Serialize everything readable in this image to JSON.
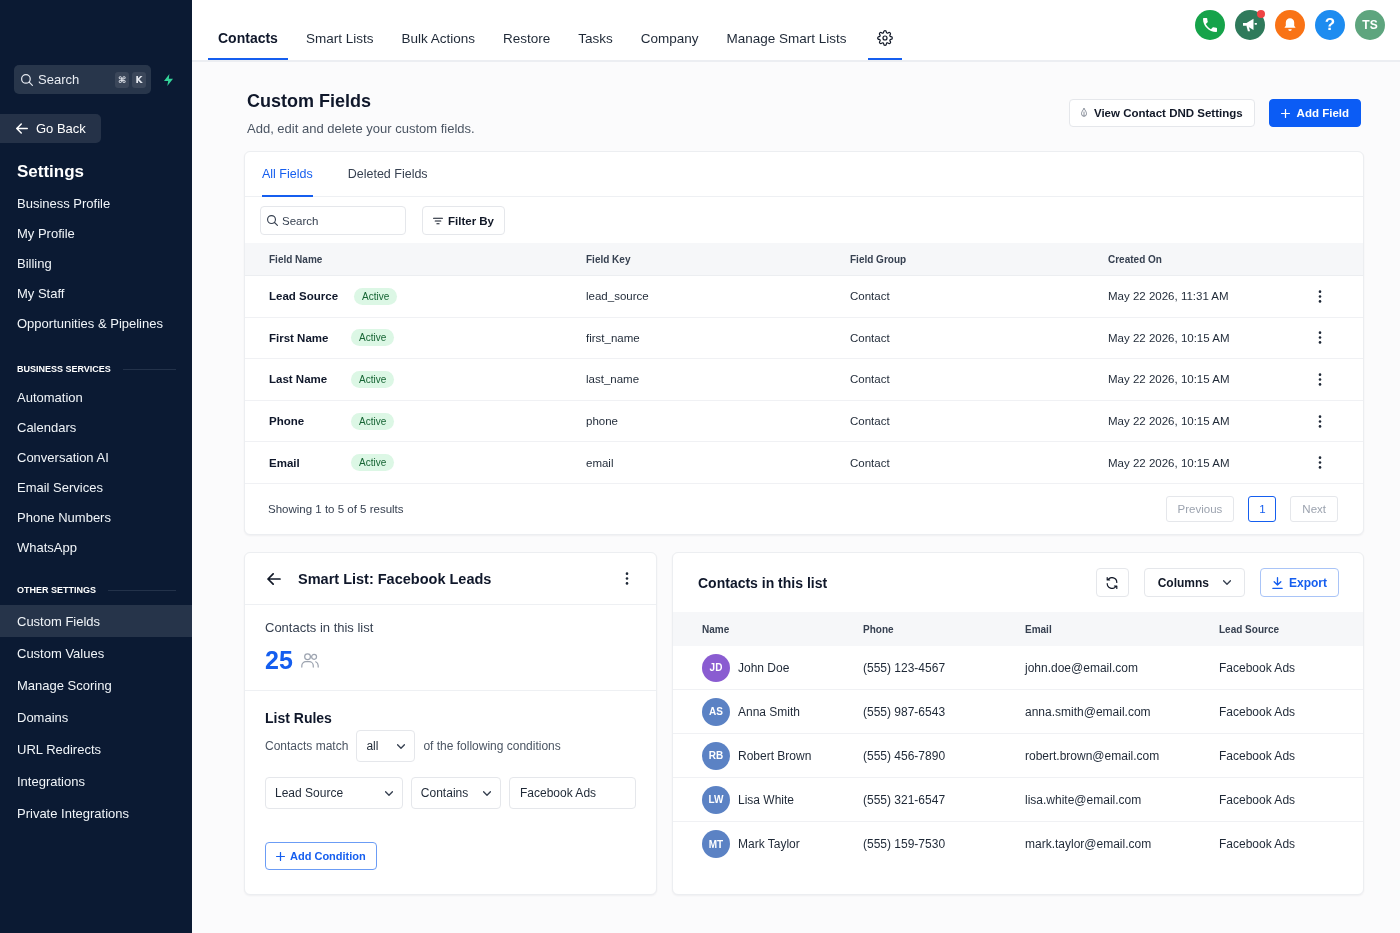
{
  "sidebar": {
    "search": {
      "placeholder": "Search",
      "shortcut": [
        "⌘",
        "K"
      ]
    },
    "back": "Go Back",
    "title": "Settings",
    "groups": [
      {
        "items": [
          {
            "label": "Business Profile",
            "selected": false
          },
          {
            "label": "My Profile",
            "selected": false
          },
          {
            "label": "Billing",
            "selected": false
          },
          {
            "label": "My Staff",
            "selected": false
          },
          {
            "label": "Opportunities & Pipelines",
            "selected": false
          }
        ]
      },
      {
        "title": "BUSINESS SERVICES",
        "items": [
          {
            "label": "Automation",
            "selected": false
          },
          {
            "label": "Calendars",
            "selected": false
          },
          {
            "label": "Conversation AI",
            "selected": false
          },
          {
            "label": "Email Services",
            "selected": false
          },
          {
            "label": "Phone Numbers",
            "selected": false
          },
          {
            "label": "WhatsApp",
            "selected": false
          }
        ]
      },
      {
        "title": "OTHER SETTINGS",
        "items": [
          {
            "label": "Custom Fields",
            "selected": true
          },
          {
            "label": "Custom Values",
            "selected": false
          },
          {
            "label": "Manage Scoring",
            "selected": false
          },
          {
            "label": "Domains",
            "selected": false
          },
          {
            "label": "URL Redirects",
            "selected": false
          },
          {
            "label": "Integrations",
            "selected": false
          },
          {
            "label": "Private Integrations",
            "selected": false
          }
        ]
      }
    ]
  },
  "topbar": {
    "tabs": [
      {
        "kind": "text",
        "label": "Contacts",
        "selected": true
      },
      {
        "kind": "text",
        "label": "Smart Lists",
        "selected": false
      },
      {
        "kind": "text",
        "label": "Bulk Actions",
        "selected": false
      },
      {
        "kind": "text",
        "label": "Restore",
        "selected": false
      },
      {
        "kind": "text",
        "label": "Tasks",
        "selected": false
      },
      {
        "kind": "text",
        "label": "Company",
        "selected": false
      },
      {
        "kind": "text",
        "label": "Manage Smart Lists",
        "selected": false
      },
      {
        "kind": "settings",
        "selected": true
      }
    ],
    "actions": [
      {
        "kind": "phone"
      },
      {
        "kind": "campaigns",
        "badge": true
      },
      {
        "kind": "notifications"
      },
      {
        "kind": "help",
        "glyph": "?"
      },
      {
        "kind": "avatar",
        "initials": "TS"
      }
    ]
  },
  "page": {
    "title": "Custom Fields",
    "subtitle": "Add, edit and delete your custom fields.",
    "actions": [
      {
        "kind": "secondary",
        "label": "View Contact DND Settings"
      },
      {
        "kind": "primary",
        "label": "Add Field"
      }
    ]
  },
  "fields_card": {
    "tabs": [
      {
        "label": "All Fields",
        "selected": true
      },
      {
        "label": "Deleted Fields",
        "selected": false
      }
    ],
    "search": {
      "placeholder": "Search"
    },
    "filter": "Filter By",
    "columns": [
      "Field Name",
      "Field Key",
      "Field Group",
      "Created On"
    ],
    "rows": [
      {
        "name": "Lead Source",
        "status": "Active",
        "key": "lead_source",
        "group": "Contact",
        "created": "May 22 2026, 11:31 AM"
      },
      {
        "name": "First Name",
        "status": "Active",
        "key": "first_name",
        "group": "Contact",
        "created": "May 22 2026, 10:15 AM"
      },
      {
        "name": "Last Name",
        "status": "Active",
        "key": "last_name",
        "group": "Contact",
        "created": "May 22 2026, 10:15 AM"
      },
      {
        "name": "Phone",
        "status": "Active",
        "key": "phone",
        "group": "Contact",
        "created": "May 22 2026, 10:15 AM"
      },
      {
        "name": "Email",
        "status": "Active",
        "key": "email",
        "group": "Contact",
        "created": "May 22 2026, 10:15 AM"
      }
    ],
    "summary": "Showing 1 to 5 of 5 results",
    "pagination": {
      "previous": {
        "label": "Previous",
        "disabled": true
      },
      "pages": [
        {
          "label": "1",
          "selected": true
        }
      ],
      "next": {
        "label": "Next",
        "disabled": true
      }
    }
  },
  "smart_list": {
    "title": "Smart List: Facebook Leads",
    "count_label": "Contacts in this list",
    "count": "25",
    "rules_title": "List Rules",
    "match_prefix": "Contacts match",
    "match_value": "all",
    "match_suffix": "of the following conditions",
    "conditions": [
      {
        "field": "Lead Source",
        "operator": "Contains",
        "value": "Facebook Ads"
      }
    ],
    "add_button": "Add Condition"
  },
  "contacts": {
    "title": "Contacts in this list",
    "columns_button": "Columns",
    "export_button": "Export",
    "columns": [
      "Name",
      "Phone",
      "Email",
      "Lead Source"
    ],
    "rows": [
      {
        "initials": "JD",
        "color": "#8a5cd1",
        "name": "John Doe",
        "phone": "(555) 123-4567",
        "email": "john.doe@email.com",
        "lead_source": "Facebook Ads"
      },
      {
        "initials": "AS",
        "color": "#5b82c4",
        "name": "Anna Smith",
        "phone": "(555) 987-6543",
        "email": "anna.smith@email.com",
        "lead_source": "Facebook Ads"
      },
      {
        "initials": "RB",
        "color": "#5b82c4",
        "name": "Robert Brown",
        "phone": "(555) 456-7890",
        "email": "robert.brown@email.com",
        "lead_source": "Facebook Ads"
      },
      {
        "initials": "LW",
        "color": "#5b82c4",
        "name": "Lisa White",
        "phone": "(555) 321-6547",
        "email": "lisa.white@email.com",
        "lead_source": "Facebook Ads"
      },
      {
        "initials": "MT",
        "color": "#5b82c4",
        "name": "Mark Taylor",
        "phone": "(555) 159-7530",
        "email": "mark.taylor@email.com",
        "lead_source": "Facebook Ads"
      }
    ]
  }
}
